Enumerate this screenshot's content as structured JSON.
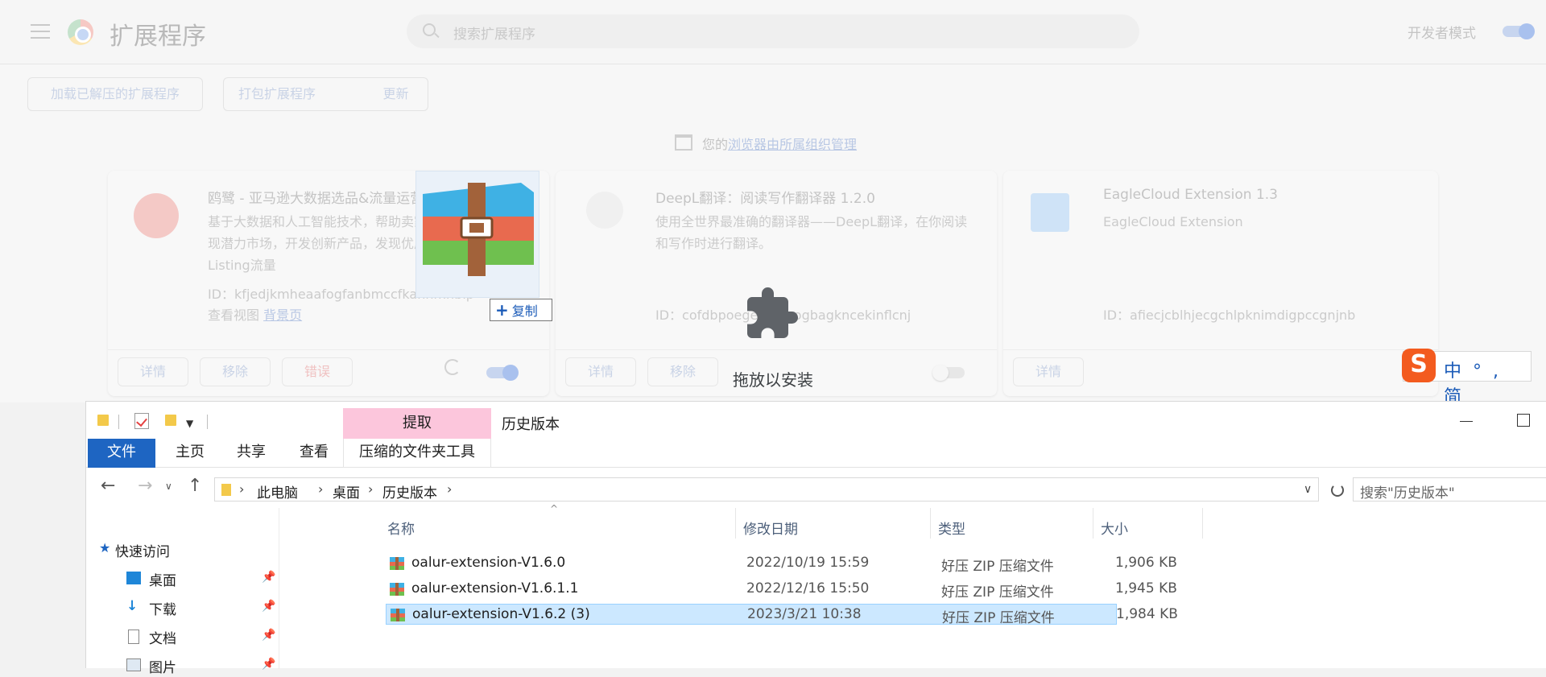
{
  "chrome": {
    "page_title": "扩展程序",
    "search_placeholder": "搜索扩展程序",
    "dev_mode_label": "开发者模式",
    "actions": {
      "load_unpacked": "加载已解压的扩展程序",
      "pack": "打包扩展程序",
      "update": "更新"
    },
    "managed_prefix": "您的",
    "managed_link": "浏览器由所属组织管理",
    "drop_text": "拖放以安装",
    "copy_tooltip": "复制",
    "copy_plus": "+",
    "cards": [
      {
        "name": "鸥鹭 - 亚马逊大数据选品&流量运营",
        "desc": "基于大数据和人工智能技术，帮助卖家发现潜力市场，开发创新产品，发现优质Listing流量",
        "id_text": "ID：kfjedjkmheaafogfanbmccfkahnmhbip",
        "view_text": "查看视图",
        "view_link": "背景页",
        "btn_details": "详情",
        "btn_remove": "移除",
        "btn_errors": "错误"
      },
      {
        "name": "DeepL翻译：阅读写作翻译器   1.2.0",
        "desc": "使用全世界最准确的翻译器——DeepL翻译，在你阅读和写作时进行翻译。",
        "id_text": "ID：cofdbpoegempjloogbagkncekinflcnj",
        "btn_details": "详情",
        "btn_remove": "移除"
      },
      {
        "name": "EagleCloud Extension   1.3",
        "desc": "EagleCloud Extension",
        "id_text": "ID：afiecjcblhjecgchlpknimdigpccgnjnb",
        "btn_details": "详情"
      }
    ],
    "ime": {
      "logo": "S",
      "text": "中°,简"
    }
  },
  "explorer": {
    "ribbon_context_tab": "提取",
    "window_title": "历史版本",
    "ribbon_tabs": {
      "file": "文件",
      "home": "主页",
      "share": "共享",
      "view": "查看",
      "tools": "压缩的文件夹工具"
    },
    "breadcrumb": [
      "此电脑",
      "桌面",
      "历史版本"
    ],
    "search_placeholder": "搜索\"历史版本\"",
    "nav_pane": [
      "快速访问",
      "桌面",
      "下载",
      "文档",
      "图片"
    ],
    "columns": [
      "名称",
      "修改日期",
      "类型",
      "大小"
    ],
    "files": [
      {
        "name": "oalur-extension-V1.6.0",
        "date": "2022/10/19 15:59",
        "type": "好压 ZIP 压缩文件",
        "size": "1,906 KB",
        "selected": false
      },
      {
        "name": "oalur-extension-V1.6.1.1",
        "date": "2022/12/16 15:50",
        "type": "好压 ZIP 压缩文件",
        "size": "1,945 KB",
        "selected": false
      },
      {
        "name": "oalur-extension-V1.6.2 (3)",
        "date": "2023/3/21 10:38",
        "type": "好压 ZIP 压缩文件",
        "size": "1,984 KB",
        "selected": true
      }
    ]
  }
}
